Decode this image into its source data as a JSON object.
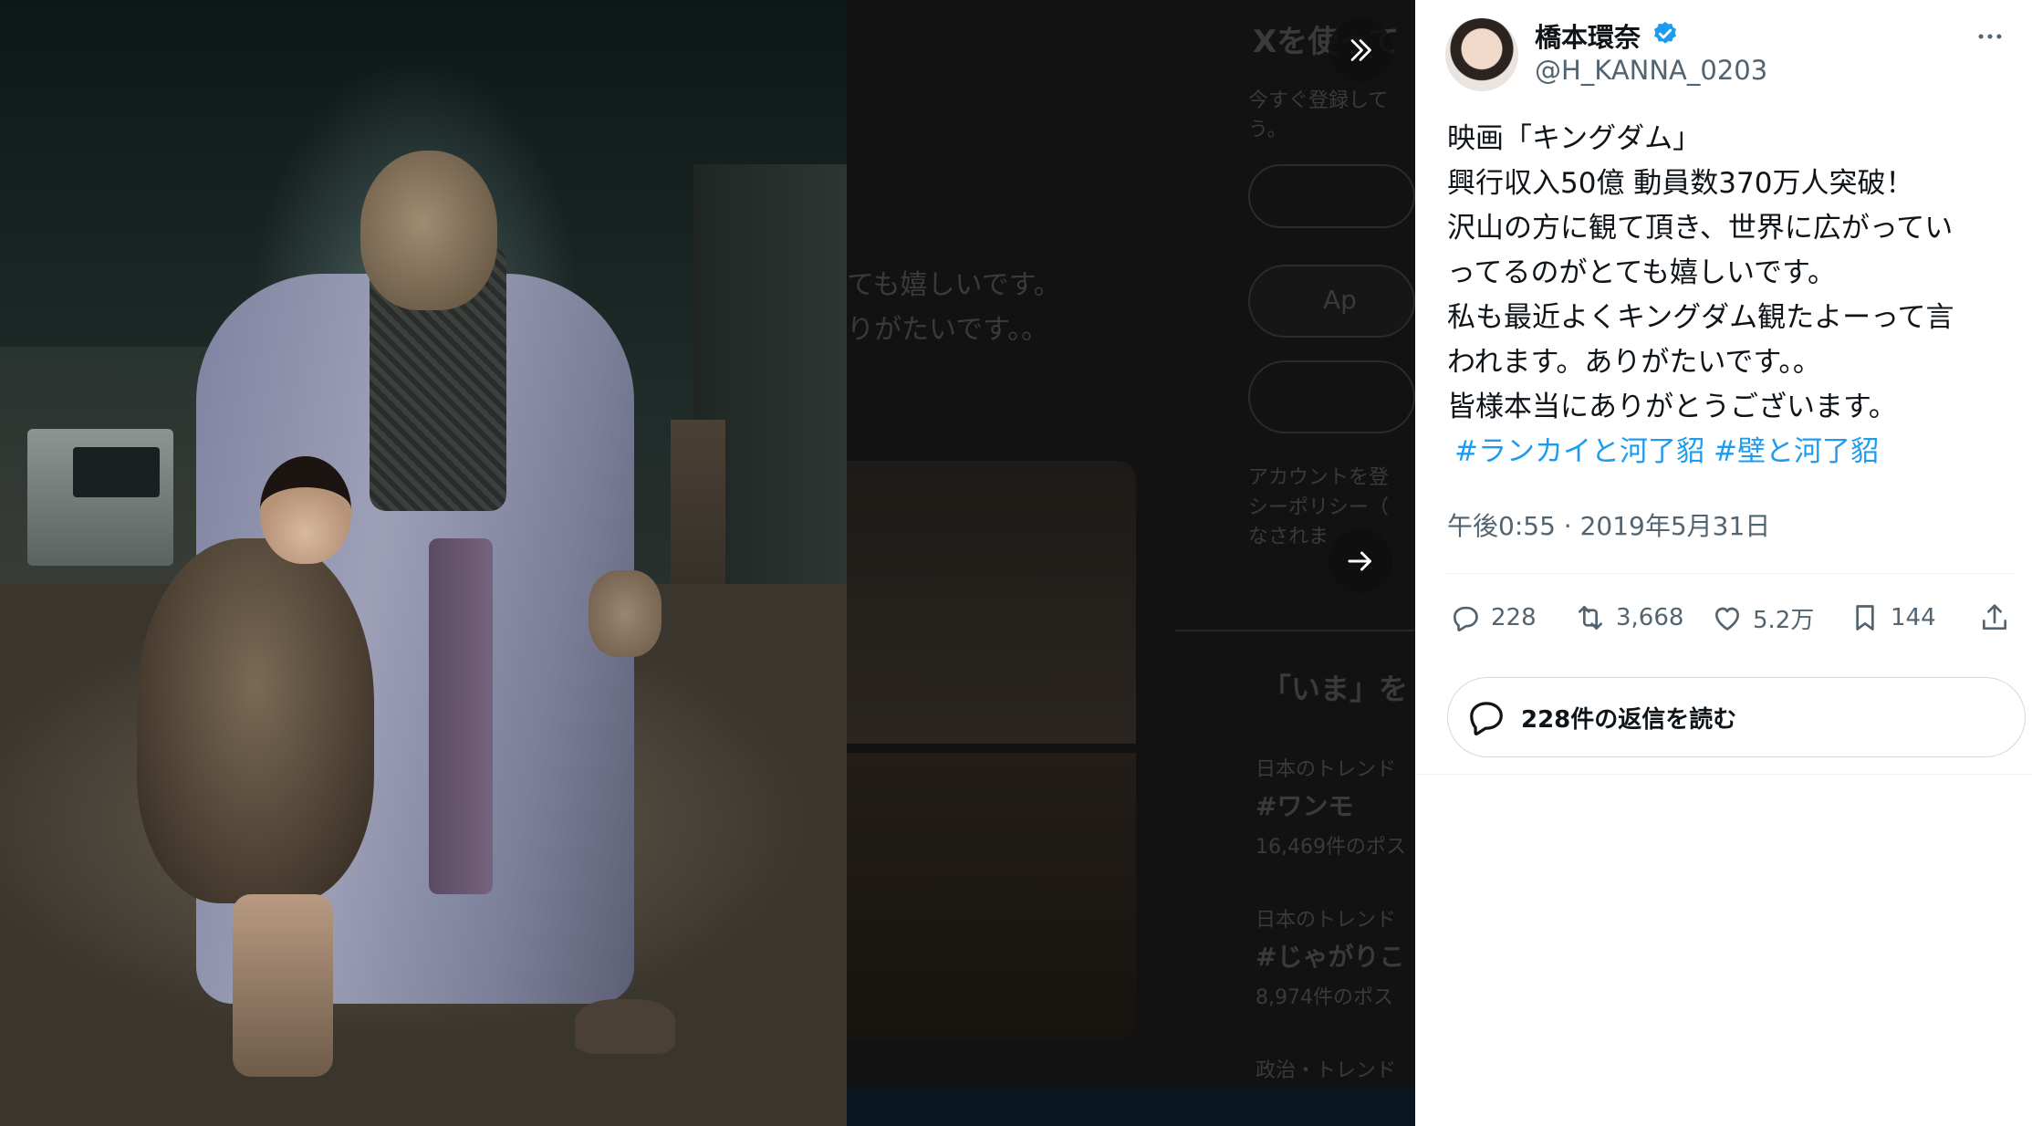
{
  "author": {
    "display_name": "橋本環奈",
    "handle": "@H_KANNA_0203",
    "verified": true
  },
  "tweet": {
    "lines": [
      "映画「キングダム」",
      "興行収入50億 動員数370万人突破！",
      "沢山の方に観て頂き、世界に広がってい",
      "ってるのがとても嬉しいです。",
      "私も最近よくキングダム観たよーって言",
      "われます。ありがたいです。。",
      "皆様本当にありがとうございます。"
    ],
    "hashtags": [
      "#ランカイと河了貂",
      "#壁と河了貂"
    ],
    "timestamp": "午後0:55 · 2019年5月31日"
  },
  "actions": {
    "replies": "228",
    "retweets": "3,668",
    "likes": "5.2万",
    "bookmarks": "144"
  },
  "read_replies_label": "228件の返信を読む",
  "background_page": {
    "title_fragment": "Xを使って",
    "subtitle_fragment_1": "今すぐ登録して",
    "subtitle_fragment_2": "う。",
    "text_fragment_1": "ても嬉しいです。",
    "text_fragment_2": "りがたいです。。",
    "apple_fragment": "Ap",
    "terms_fragment_1": "アカウントを登",
    "terms_fragment_2": "シーポリシー（",
    "terms_fragment_3": "なされま",
    "trends_heading_fragment": "「いま」を",
    "trend_1_context": "日本のトレンド",
    "trend_1_name": "#ワンモ",
    "trend_1_count": "16,469件のポス",
    "trend_2_context": "日本のトレンド",
    "trend_2_name": "#じゃがりこ",
    "trend_2_count": "8,974件のポス",
    "trend_3_context": "政治・トレンド"
  },
  "colors": {
    "link": "#1d9bf0",
    "text_primary": "#0f1419",
    "text_secondary": "#536471",
    "verified_badge": "#1d9bf0"
  },
  "icons": {
    "collapse": "double-chevron-right-icon",
    "next": "arrow-right-icon",
    "reply": "speech-bubble-icon",
    "retweet": "retweet-icon",
    "like": "heart-icon",
    "bookmark": "bookmark-icon",
    "share": "share-icon",
    "more": "more-horizontal-icon"
  }
}
